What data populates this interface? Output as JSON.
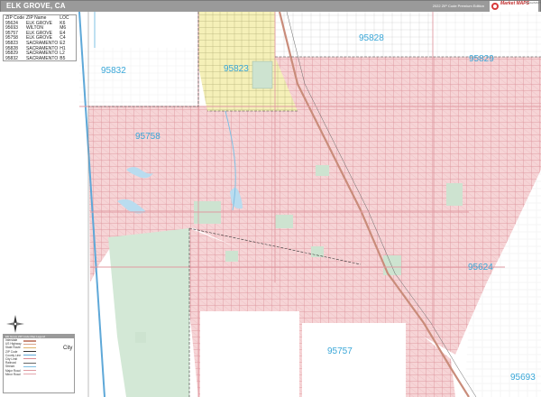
{
  "header": {
    "title": "ELK GROVE, CA",
    "edition": "2022 ZIP Code Premium Edition",
    "logo_text": "Market MAPS",
    "logo_sub": "MarketMAPS.com"
  },
  "zip_table": {
    "columns": [
      "ZIP Code",
      "ZIP Name",
      "LOC"
    ],
    "rows": [
      [
        "95624",
        "ELK GROVE",
        "K6"
      ],
      [
        "95693",
        "WILTON",
        "M6"
      ],
      [
        "95757",
        "ELK GROVE",
        "E4"
      ],
      [
        "95758",
        "ELK GROVE",
        "C4"
      ],
      [
        "95823",
        "SACRAMENTO",
        "E2"
      ],
      [
        "95828",
        "SACRAMENTO",
        "H1"
      ],
      [
        "95829",
        "SACRAMENTO",
        "L2"
      ],
      [
        "95832",
        "SACRAMENTO",
        "B5"
      ]
    ]
  },
  "zip_labels": {
    "z95828": "95828",
    "z95829": "95829",
    "z95832": "95832",
    "z95823": "95823",
    "z95758": "95758",
    "z95624": "95624",
    "z95757": "95757",
    "z95693": "95693"
  },
  "legend": {
    "title": "Elk Grove ZIP Code Map Legend",
    "items": [
      "Interstate",
      "US Highway",
      "State Route",
      "ZIP Code",
      "County Line",
      "City Limit",
      "Railroad",
      "Stream",
      "Major Road",
      "Minor Road"
    ],
    "city_label": "City"
  },
  "colors": {
    "zip_pink": "#f6d4d6",
    "zip_yellow": "#f5f0b8",
    "park_green": "#d3e8d6",
    "background": "#ffffff",
    "water": "#b9dcef",
    "zip_label": "#3aa7d8",
    "highway": "#c98c7a"
  }
}
